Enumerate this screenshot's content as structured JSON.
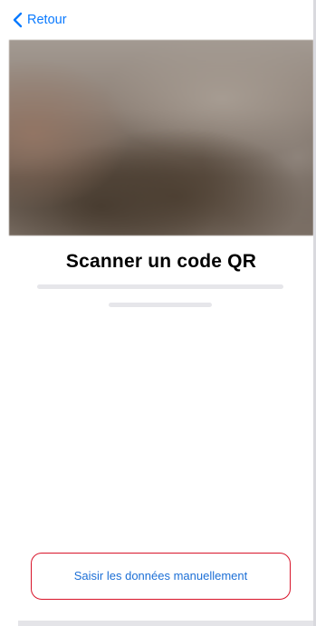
{
  "nav": {
    "back_label": "Retour",
    "back_icon": "chevron-left-icon"
  },
  "colors": {
    "accent": "#0a7aff",
    "button_border": "#d8142a",
    "button_text": "#1c6fd6",
    "placeholder": "#e6e6ea"
  },
  "scanner": {
    "title": "Scanner un code QR"
  },
  "actions": {
    "manual_entry_label": "Saisir les données manuellement"
  }
}
